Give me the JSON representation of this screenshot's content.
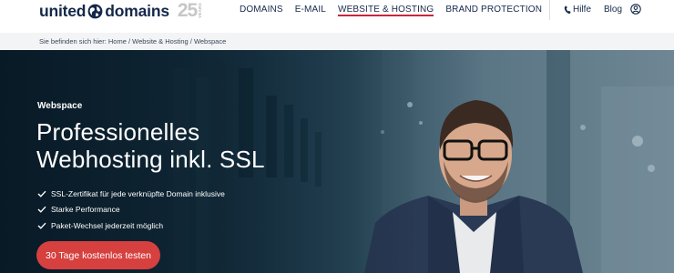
{
  "header": {
    "logo": {
      "word1": "united",
      "word2": "domains",
      "anniversary": "25",
      "years": "YEARS"
    },
    "nav": [
      {
        "label": "DOMAINS",
        "active": false
      },
      {
        "label": "E-MAIL",
        "active": false
      },
      {
        "label": "WEBSITE & HOSTING",
        "active": true
      },
      {
        "label": "BRAND PROTECTION",
        "active": false
      }
    ],
    "help_label": "Hilfe",
    "blog_label": "Blog",
    "account_icon": "user-circle-icon"
  },
  "breadcrumb": {
    "text": "Sie befinden sich hier: Home / Website & Hosting / Webspace"
  },
  "hero": {
    "eyebrow": "Webspace",
    "headline_line1": "Professionelles",
    "headline_line2": "Webhosting inkl. SSL",
    "features": [
      "SSL-Zertifikat für jede verknüpfte Domain inklusive",
      "Starke Performance",
      "Paket-Wechsel jederzeit möglich"
    ],
    "cta_label": "30 Tage kostenlos testen"
  },
  "colors": {
    "brand_navy": "#15284a",
    "accent_red": "#c9253a",
    "cta_red": "#d6403f"
  }
}
